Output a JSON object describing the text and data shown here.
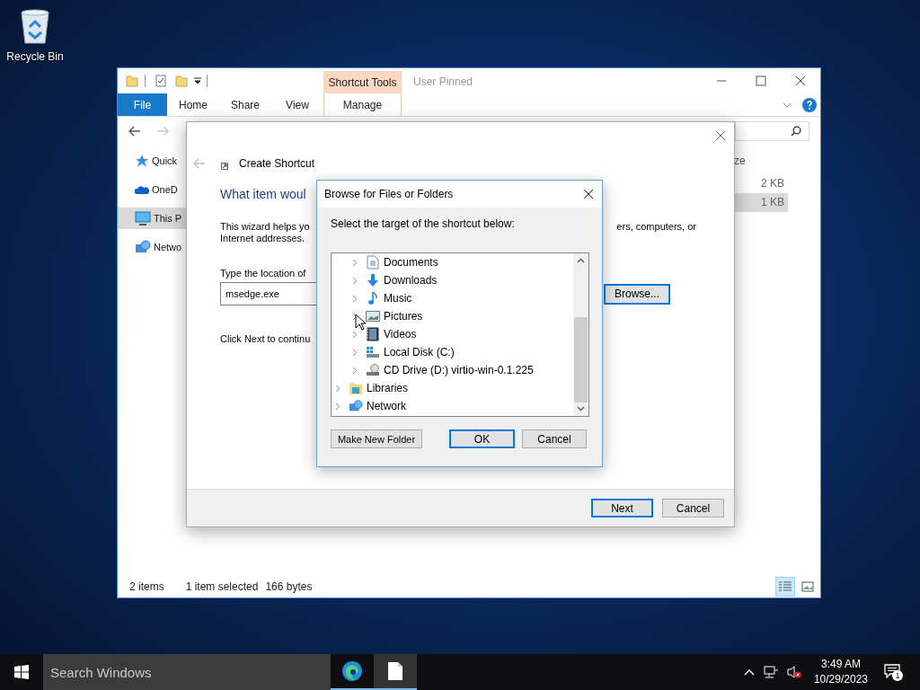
{
  "desktop": {
    "icons": [
      {
        "label": "Recycle Bin"
      }
    ]
  },
  "explorer": {
    "contextual_group": "Shortcut Tools",
    "title": "User Pinned",
    "tabs": [
      {
        "label": "File",
        "kind": "file"
      },
      {
        "label": "Home",
        "kind": "plain"
      },
      {
        "label": "Share",
        "kind": "plain"
      },
      {
        "label": "View",
        "kind": "plain"
      },
      {
        "label": "Manage",
        "kind": "contextual"
      }
    ],
    "nav_items": [
      {
        "label": "Quick",
        "kind": "star",
        "selected": false
      },
      {
        "label": "OneD",
        "kind": "cloud",
        "selected": false
      },
      {
        "label": "This P",
        "kind": "pc",
        "selected": true
      },
      {
        "label": "Netwo",
        "kind": "network",
        "selected": false
      }
    ],
    "column_header": "ze",
    "rows": [
      {
        "size": "2 KB",
        "selected": false
      },
      {
        "size": "1 KB",
        "selected": true
      }
    ],
    "status": {
      "item_count": "2 items",
      "selection": "1 item selected",
      "selection_size": "166 bytes"
    },
    "views": [
      {
        "kind": "details",
        "selected": true
      },
      {
        "kind": "thumbnails",
        "selected": false
      }
    ]
  },
  "wizard": {
    "title": "Create Shortcut",
    "heading": "What item woul",
    "description_start": "This wizard helps yo",
    "description_tail": "ers, computers, or",
    "description_line2": "Internet addresses.",
    "location_label": "Type the location of",
    "location_value": "msedge.exe",
    "browse_button": "Browse...",
    "hint": "Click Next to continu",
    "buttons": [
      {
        "label": "Next",
        "default": true
      },
      {
        "label": "Cancel",
        "default": false
      }
    ]
  },
  "browse_dialog": {
    "title": "Browse for Files or Folders",
    "prompt": "Select the target of the shortcut below:",
    "tree": {
      "nested_items": [
        {
          "label": "Documents",
          "kind": "documents"
        },
        {
          "label": "Downloads",
          "kind": "downloads"
        },
        {
          "label": "Music",
          "kind": "music"
        },
        {
          "label": "Pictures",
          "kind": "pictures"
        },
        {
          "label": "Videos",
          "kind": "videos"
        },
        {
          "label": "Local Disk (C:)",
          "kind": "disk"
        },
        {
          "label": "CD Drive (D:) virtio-win-0.1.225",
          "kind": "cd"
        }
      ],
      "items": [
        {
          "label": "Libraries",
          "kind": "libraries"
        },
        {
          "label": "Network",
          "kind": "network"
        }
      ]
    },
    "buttons": [
      {
        "label": "Make New Folder",
        "default": false
      },
      {
        "label": "OK",
        "default": true
      },
      {
        "label": "Cancel",
        "default": false
      }
    ]
  },
  "taskbar": {
    "search_placeholder": "Search Windows",
    "apps": [
      {
        "kind": "edge",
        "selected": false
      },
      {
        "kind": "file",
        "selected": true
      }
    ],
    "time": "3:49 AM",
    "date": "10/29/2023",
    "notification_count": "1"
  }
}
